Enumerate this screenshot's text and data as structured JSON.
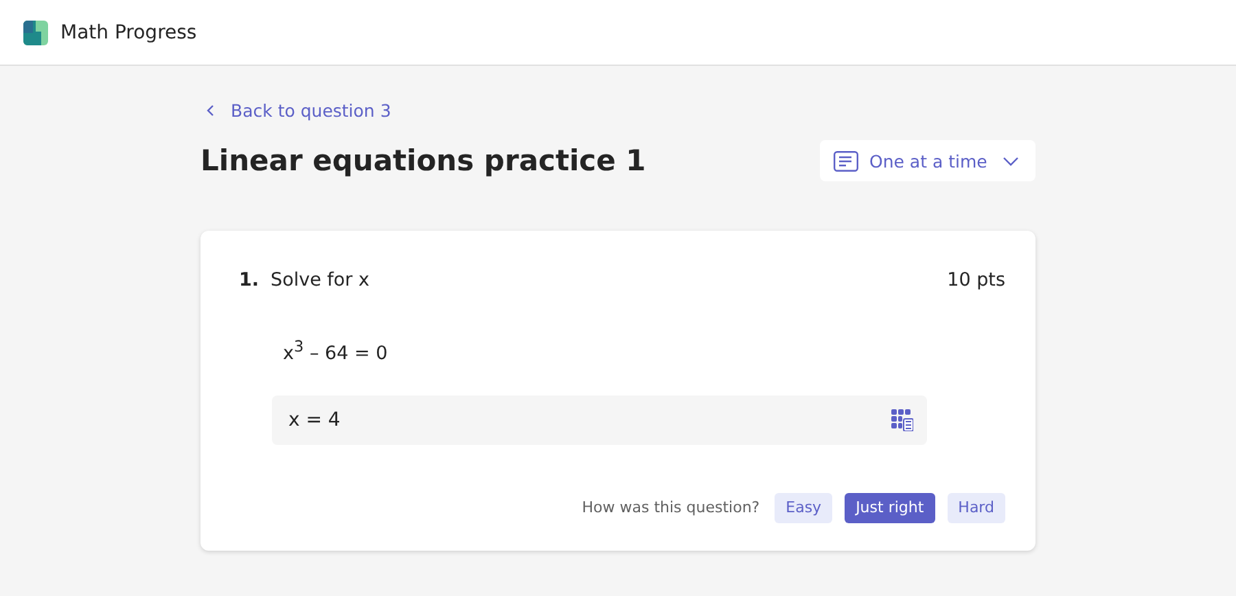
{
  "app": {
    "title": "Math Progress"
  },
  "back_link": "Back to question 3",
  "page_title": "Linear equations practice 1",
  "view_dropdown": {
    "value": "One at a time"
  },
  "question": {
    "number": "1.",
    "prompt": "Solve for x",
    "points": "10 pts",
    "equation": "x$^{3}$ – 64 = 0",
    "answer": "x = 4"
  },
  "feedback": {
    "prompt": "How was this question?",
    "options": [
      {
        "label": "Easy",
        "selected": false
      },
      {
        "label": "Just right",
        "selected": true
      },
      {
        "label": "Hard",
        "selected": false
      }
    ]
  }
}
